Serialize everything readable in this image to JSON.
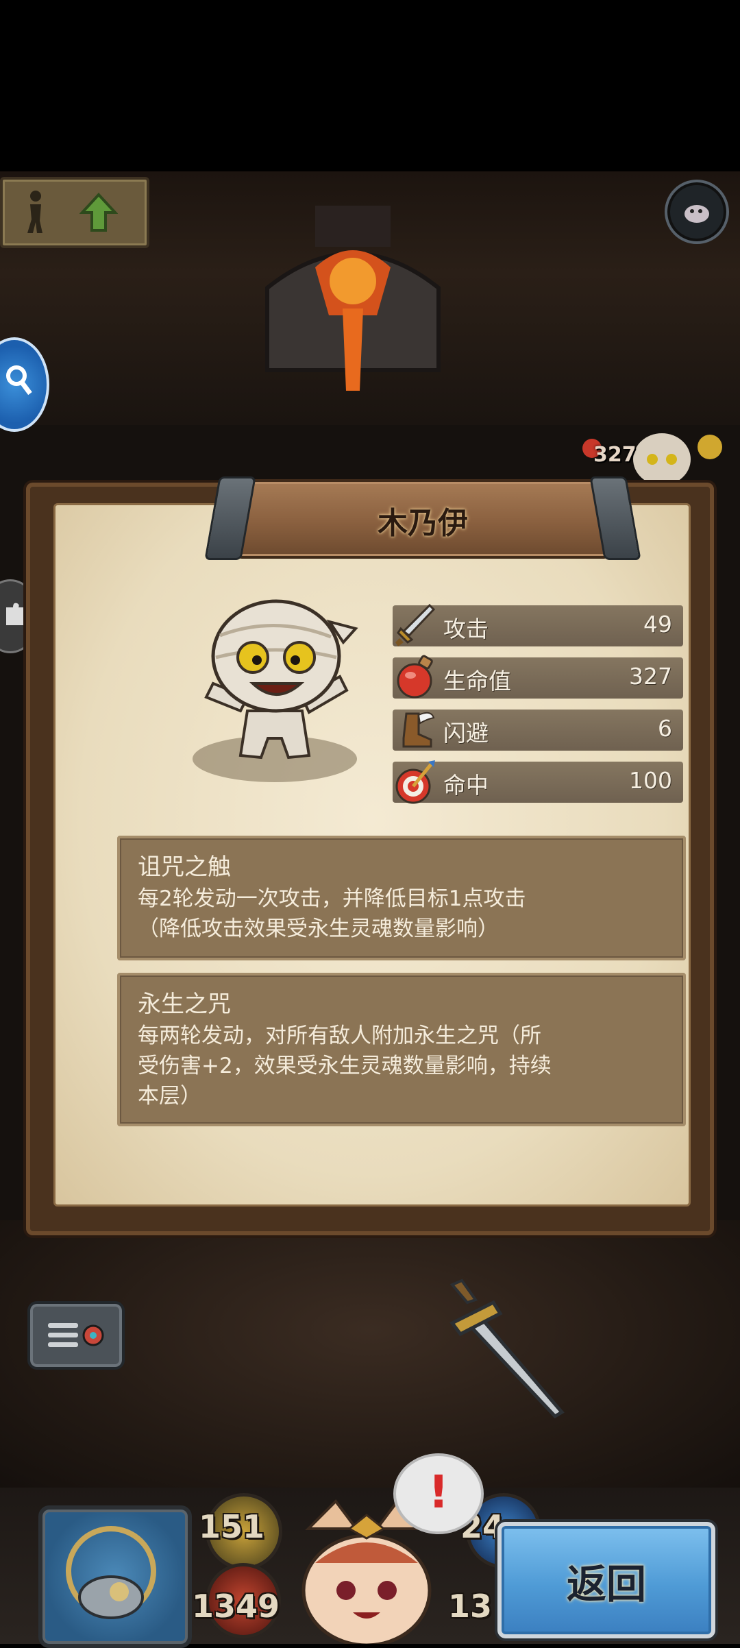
{
  "monster": {
    "name": "木乃伊",
    "stats": [
      {
        "label": "攻击",
        "value": "49",
        "icon": "sword-icon"
      },
      {
        "label": "生命值",
        "value": "327",
        "icon": "potion-icon"
      },
      {
        "label": "闪避",
        "value": "6",
        "icon": "winged-boot-icon"
      },
      {
        "label": "命中",
        "value": "100",
        "icon": "target-icon"
      }
    ],
    "skills": [
      {
        "name": "诅咒之触",
        "desc": "每2轮发动一次攻击，并降低目标1点攻击\n（降低攻击效果受永生灵魂数量影响）"
      },
      {
        "name": "永生之咒",
        "desc": "每两轮发动，对所有敌人附加永生之咒（所\n受伤害+2，效果受永生灵魂数量影响，持续\n本层）"
      }
    ]
  },
  "background": {
    "enemy_hp_tag": "327"
  },
  "hud": {
    "attack": "151",
    "hp": "1349",
    "defense_partial": "24",
    "gold_partial": "13"
  },
  "back_button": {
    "label": "返回"
  },
  "alert": {
    "mark": "!"
  }
}
